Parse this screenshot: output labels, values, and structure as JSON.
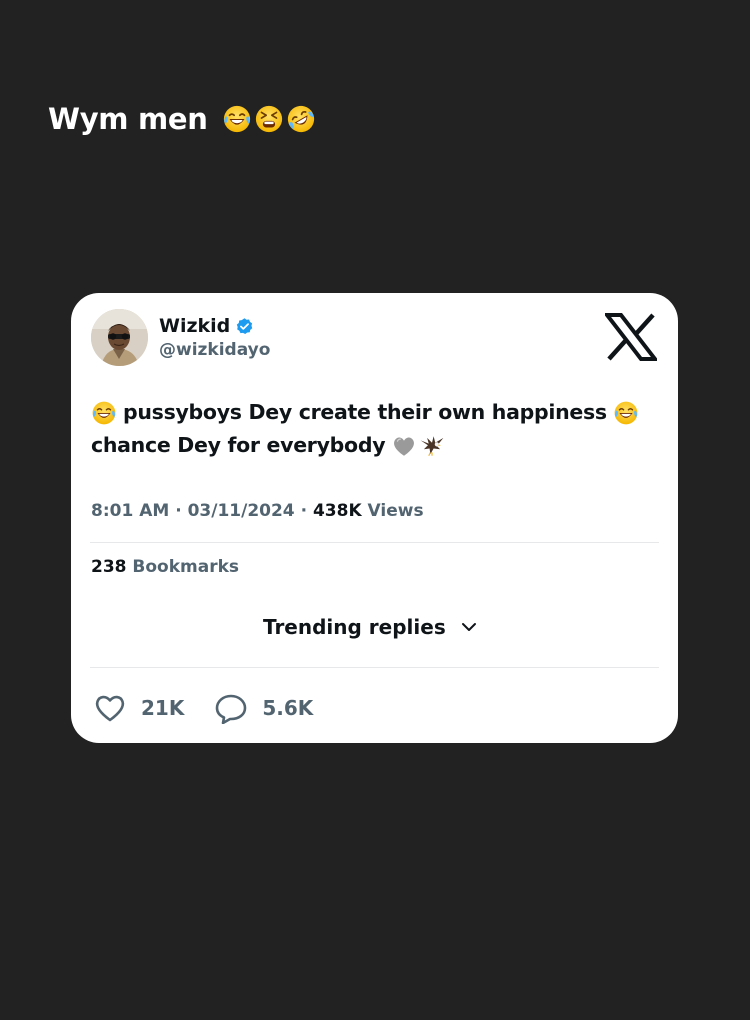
{
  "story": {
    "caption": "Wym men",
    "caption_emojis": [
      "tears-of-joy-emoji",
      "tired-face-emoji",
      "rolling-on-floor-laughing-emoji"
    ]
  },
  "tweet": {
    "author": {
      "name": "Wizkid",
      "handle": "@wizkidayo",
      "verified": true
    },
    "text_line1": "pussyboys Dey create their own happiness",
    "text_line2": "chance Dey for everybody",
    "text_emojis": [
      "tears-of-joy-emoji",
      "tears-of-joy-emoji",
      "grey-heart-emoji",
      "eagle-emoji"
    ],
    "time": "8:01 AM",
    "date": "03/11/2024",
    "views_count": "438K",
    "views_label": "Views",
    "bookmarks_count": "238",
    "bookmarks_label": "Bookmarks",
    "trending_label": "Trending replies",
    "likes": "21K",
    "replies": "5.6K"
  },
  "colors": {
    "background": "#222222",
    "card": "#ffffff",
    "text_primary": "#0f1419",
    "text_secondary": "#536471",
    "verified_blue": "#1d9bf0"
  }
}
